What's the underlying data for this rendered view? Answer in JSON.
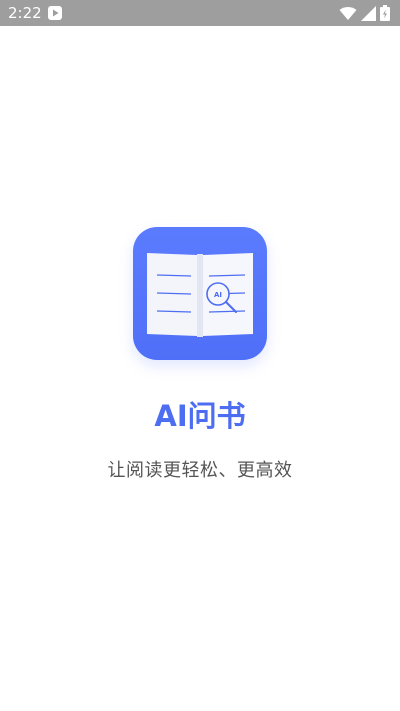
{
  "status_bar": {
    "time": "2:22",
    "icons": [
      "play-icon",
      "wifi-icon",
      "signal-icon",
      "battery-icon"
    ],
    "background": "#9e9e9e"
  },
  "app": {
    "icon_name": "book-magnifier-icon",
    "icon_label": "AI",
    "name": "AI问书",
    "tagline": "让阅读更轻松、更高效",
    "accent_color": "#4e6ef2"
  }
}
